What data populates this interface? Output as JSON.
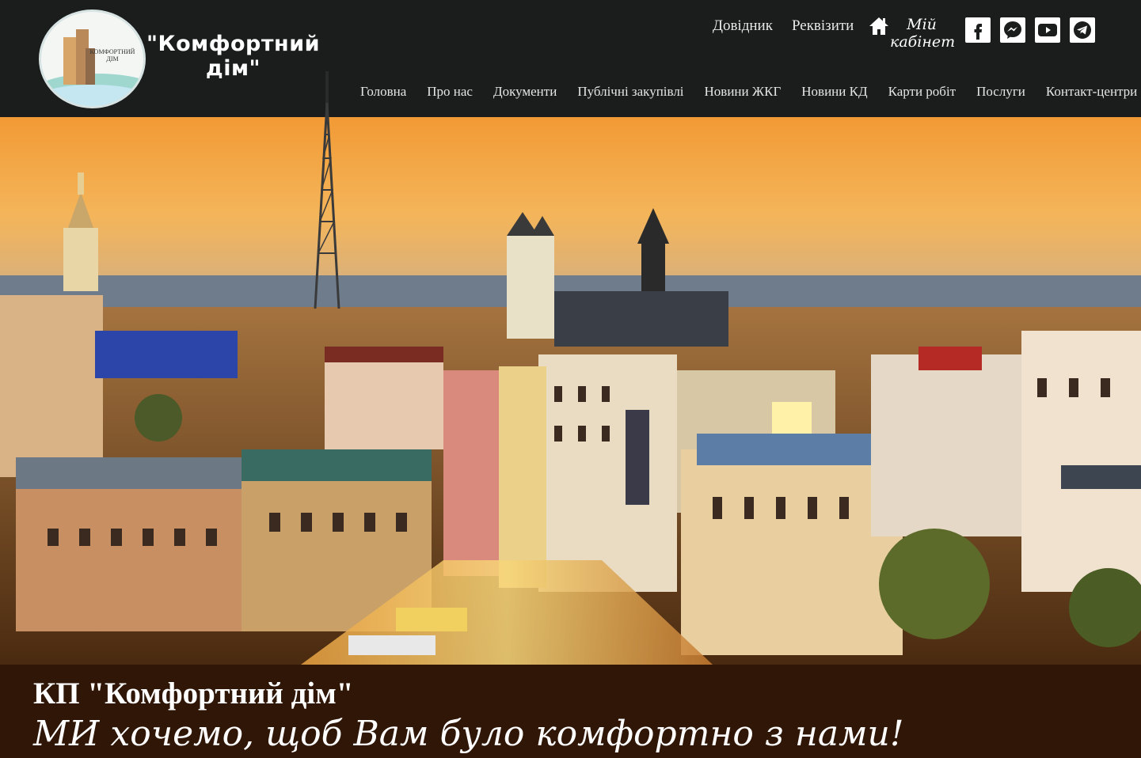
{
  "header": {
    "logo_text": "КОМФОРТНИЙ ДІМ",
    "brand_title": "\"Комфортний дім\"",
    "top_links": [
      "Довідник",
      "Реквізити"
    ],
    "cabinet_label": "Мій кабінет",
    "social": [
      "facebook-icon",
      "messenger-icon",
      "youtube-icon",
      "telegram-icon"
    ]
  },
  "nav": {
    "items": [
      "Головна",
      "Про нас",
      "Документи",
      "Публічні закупівлі",
      "Новини ЖКГ",
      "Новини КД",
      "Карти робіт",
      "Послуги",
      "Контакт-центри"
    ]
  },
  "banner": {
    "title": "КП \"Комфортний дім\"",
    "slogan": "МИ хочемо, щоб Вам було комфортно з нами!"
  },
  "colors": {
    "header_bg": "#1b1c1c",
    "banner_bg": "#2f1607",
    "sky_top": "#f2a13e"
  }
}
